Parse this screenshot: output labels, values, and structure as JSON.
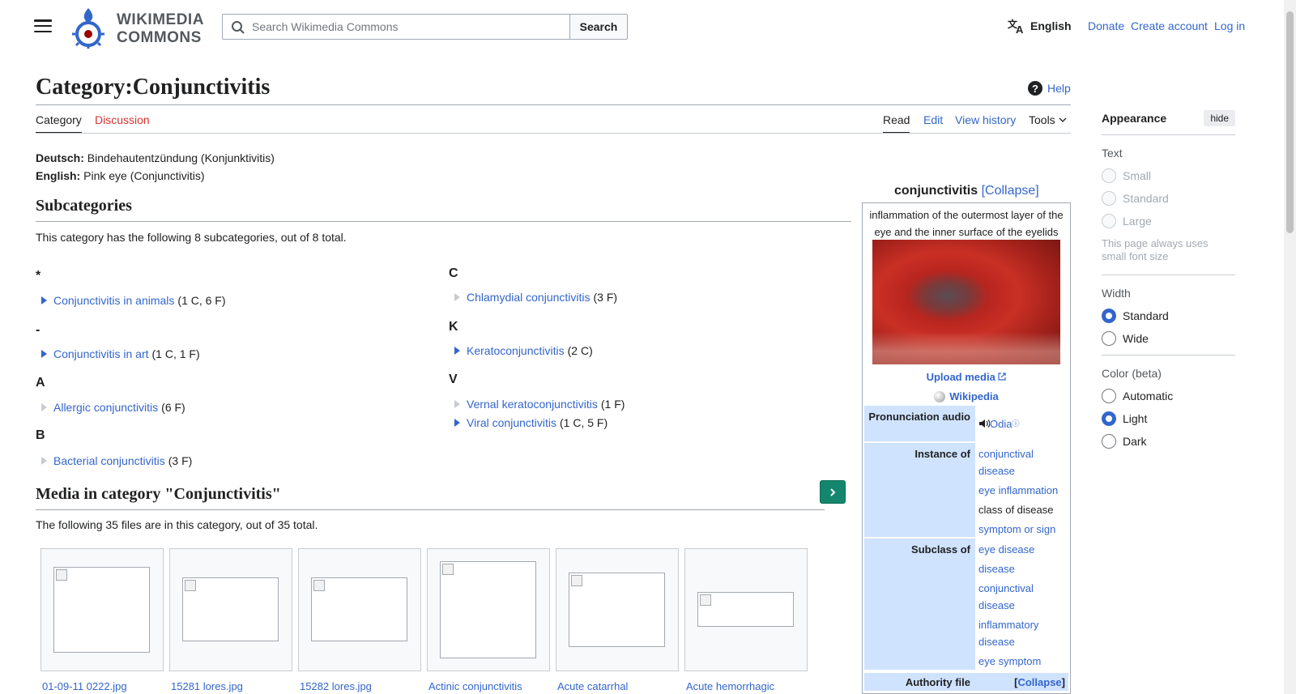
{
  "header": {
    "logo_line1": "WIKIMEDIA",
    "logo_line2": "COMMONS",
    "search_placeholder": "Search Wikimedia Commons",
    "search_button": "Search",
    "language": "English",
    "links": [
      "Donate",
      "Create account",
      "Log in"
    ]
  },
  "page": {
    "title": "Category:Conjunctivitis",
    "help": "Help",
    "tabs_left": [
      "Category",
      "Discussion"
    ],
    "tabs_right": [
      "Read",
      "Edit",
      "View history",
      "Tools"
    ],
    "labels": [
      {
        "lang": "Deutsch:",
        "text": "Bindehautentzündung (Konjunktivitis)"
      },
      {
        "lang": "English:",
        "text": "Pink eye (Conjunctivitis)"
      }
    ]
  },
  "subcategories": {
    "heading": "Subcategories",
    "summary": "This category has the following 8 subcategories, out of 8 total.",
    "col1": [
      {
        "letter": "*",
        "name": "Conjunctivitis in animals",
        "count": "(1 C, 6 F)",
        "expandable": true
      },
      {
        "letter": "-",
        "name": "Conjunctivitis in art",
        "count": "(1 C, 1 F)",
        "expandable": true
      },
      {
        "letter": "A",
        "name": "Allergic conjunctivitis",
        "count": "(6 F)",
        "expandable": false
      },
      {
        "letter": "B",
        "name": "Bacterial conjunctivitis",
        "count": "(3 F)",
        "expandable": false
      }
    ],
    "col2": [
      {
        "letter": "C",
        "name": "Chlamydial conjunctivitis",
        "count": "(3 F)",
        "expandable": false
      },
      {
        "letter": "K",
        "name": "Keratoconjunctivitis",
        "count": "(2 C)",
        "expandable": true
      },
      {
        "letter": "V",
        "name": "Vernal keratoconjunctivitis",
        "count": "(1 F)",
        "expandable": false
      },
      {
        "letter": "",
        "name": "Viral conjunctivitis",
        "count": "(1 C, 5 F)",
        "expandable": true
      }
    ]
  },
  "media": {
    "heading": "Media in category \"Conjunctivitis\"",
    "summary": "The following 35 files are in this category, out of 35 total.",
    "files": [
      "01-09-11 0222.jpg",
      "15281 lores.jpg",
      "15282 lores.jpg",
      "Actinic conjunctivitis",
      "Acute catarrhal",
      "Acute hemorrhagic"
    ]
  },
  "infobox": {
    "title": "conjunctivitis",
    "collapse": "[Collapse]",
    "description": "inflammation of the outermost layer of the eye and the inner surface of the eyelids",
    "upload": "Upload media",
    "wikipedia": "Wikipedia",
    "pronunciation_label": "Pronunciation audio",
    "pronunciation_value": "Odia",
    "instance_label": "Instance of",
    "instance_values": [
      "conjunctival disease",
      "eye inflammation",
      "class of disease",
      "symptom or sign"
    ],
    "subclass_label": "Subclass of",
    "subclass_values": [
      "eye disease",
      "disease",
      "conjunctival disease",
      "inflammatory disease",
      "eye symptom"
    ],
    "authority_label": "Authority file",
    "authority_collapse": "Collapse"
  },
  "appearance": {
    "title": "Appearance",
    "hide": "hide",
    "text_label": "Text",
    "text_options": [
      "Small",
      "Standard",
      "Large"
    ],
    "text_note": "This page always uses small font size",
    "width_label": "Width",
    "width_options": [
      "Standard",
      "Wide"
    ],
    "width_selected": "Standard",
    "color_label": "Color (beta)",
    "color_options": [
      "Automatic",
      "Light",
      "Dark"
    ],
    "color_selected": "Light"
  },
  "colors": {
    "link": "#3366cc",
    "red_link": "#d73333",
    "infobox_label_bg": "#cfe3ff",
    "green_button": "#14866d"
  }
}
